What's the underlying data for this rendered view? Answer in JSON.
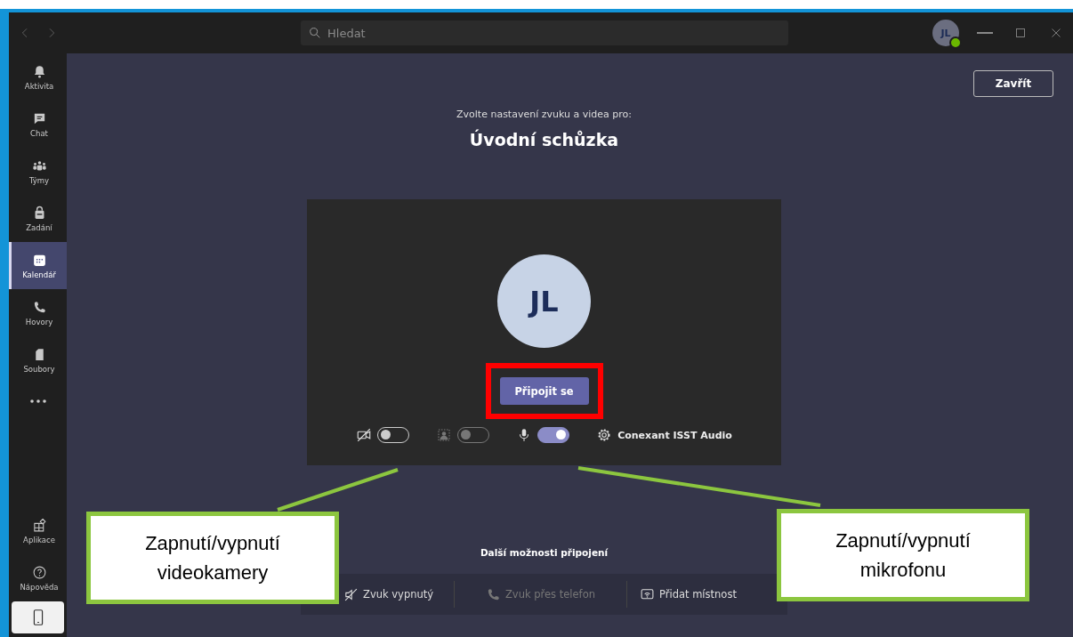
{
  "title_bar": {
    "search": {
      "placeholder": "Hledat"
    },
    "avatar": {
      "initials": "JL"
    }
  },
  "sidebar": {
    "items": [
      {
        "label": "Aktivita",
        "selected": false
      },
      {
        "label": "Chat",
        "selected": false
      },
      {
        "label": "Týmy",
        "selected": false
      },
      {
        "label": "Zadání",
        "selected": false
      },
      {
        "label": "Kalendář",
        "selected": true
      },
      {
        "label": "Hovory",
        "selected": false
      },
      {
        "label": "Soubory",
        "selected": false
      }
    ],
    "bottom_items": [
      {
        "label": "Aplikace"
      },
      {
        "label": "Nápověda"
      }
    ]
  },
  "main": {
    "close_button": "Zavřít",
    "subtitle": "Zvolte nastavení zvuku a videa pro:",
    "title": "Úvodní schůzka",
    "preview": {
      "initials": "JL",
      "join_button": "Připojit se",
      "controls": [
        {
          "kind": "video",
          "on": false,
          "disabled": false
        },
        {
          "kind": "background",
          "on": false,
          "disabled": true
        },
        {
          "kind": "mic",
          "on": true,
          "disabled": false
        }
      ],
      "device": "Conexant ISST Audio"
    },
    "more_options": {
      "title": "Další možnosti připojení",
      "options": [
        {
          "label": "Zvuk vypnutý",
          "disabled": false
        },
        {
          "label": "Zvuk přes telefon",
          "disabled": true
        },
        {
          "label": "Přidat místnost",
          "disabled": false
        }
      ]
    }
  },
  "annotations": [
    {
      "text": "Zapnutí/vypnutí videokamery"
    },
    {
      "text": "Zapnutí/vypnutí mikrofonu"
    }
  ]
}
